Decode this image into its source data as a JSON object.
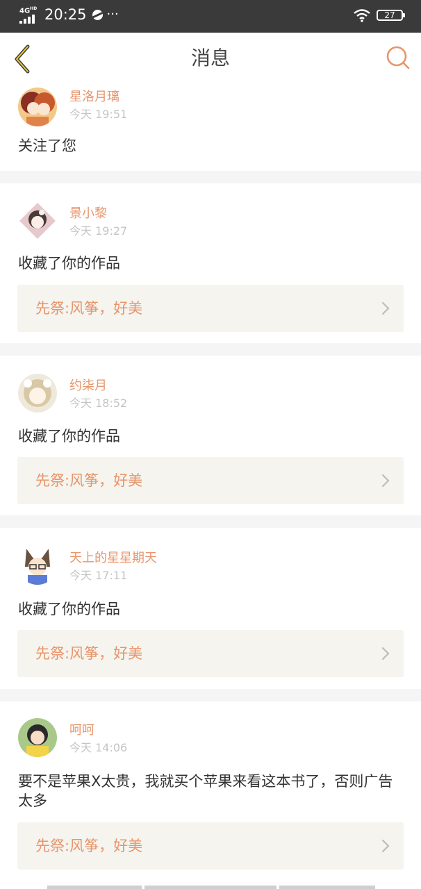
{
  "status_bar": {
    "network": "4G",
    "network_sup": "HD",
    "time": "20:25",
    "more": "···",
    "battery": "27"
  },
  "header": {
    "title": "消息",
    "accent_color": "#e8956b"
  },
  "messages": [
    {
      "user": "星洛月璃",
      "time": "今天 19:51",
      "text": "关注了您",
      "work": null
    },
    {
      "user": "景小黎",
      "time": "今天 19:27",
      "text": "收藏了你的作品",
      "work": "先祭:风筝，好美"
    },
    {
      "user": "约柒月",
      "time": "今天 18:52",
      "text": "收藏了你的作品",
      "work": "先祭:风筝，好美"
    },
    {
      "user": "天上的星星期天",
      "time": "今天 17:11",
      "text": "收藏了你的作品",
      "work": "先祭:风筝，好美"
    },
    {
      "user": "呵呵",
      "time": "今天 14:06",
      "text": "要不是苹果X太贵，我就买个苹果来看这本书了，否则广告太多",
      "work": "先祭:风筝，好美"
    }
  ]
}
